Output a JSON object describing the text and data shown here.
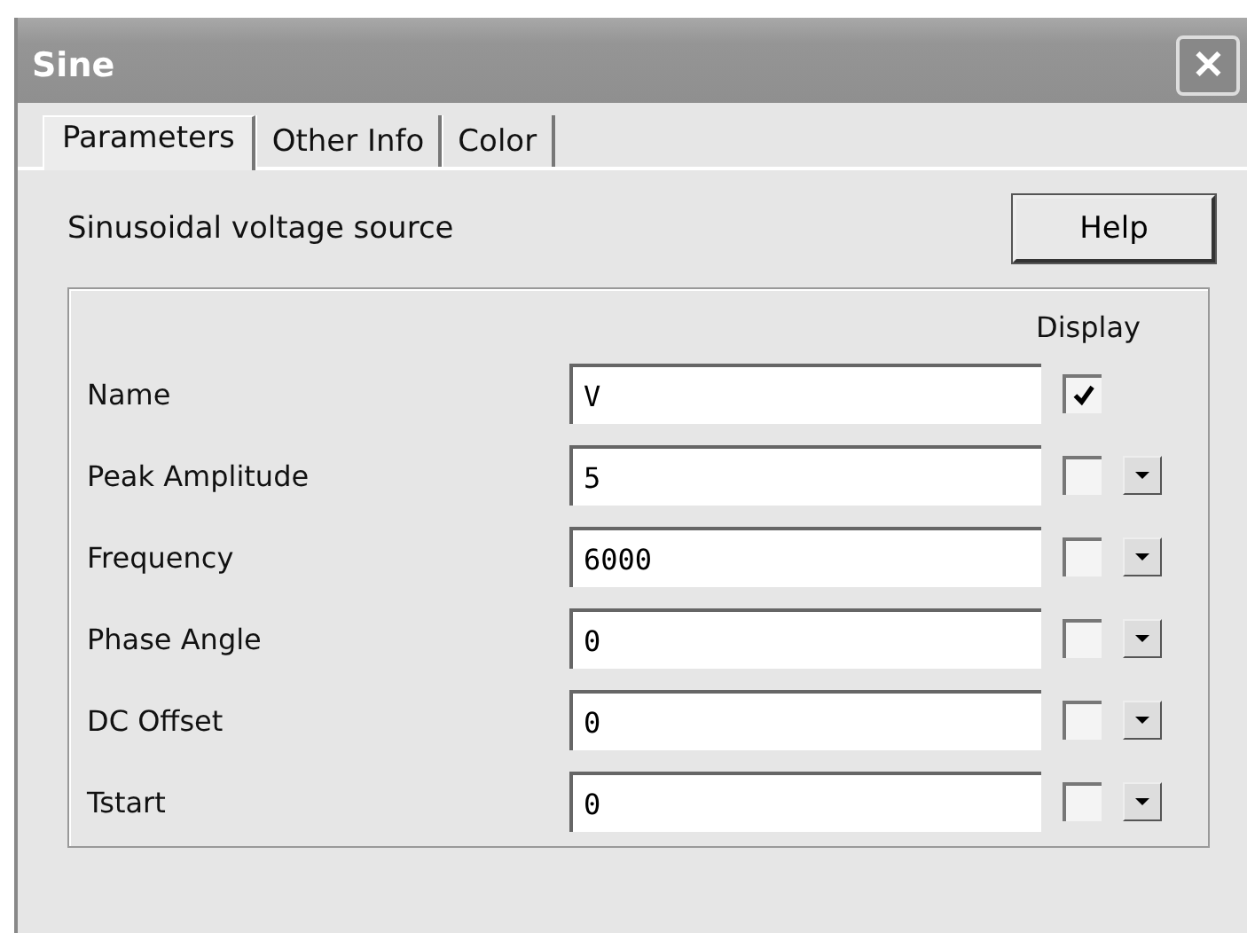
{
  "window": {
    "title": "Sine",
    "close": "✕"
  },
  "tabs": [
    {
      "label": "Parameters",
      "selected": true
    },
    {
      "label": "Other Info",
      "selected": false
    },
    {
      "label": "Color",
      "selected": false
    }
  ],
  "description": "Sinusoidal voltage source",
  "help_button": "Help",
  "display_header": "Display",
  "rows": [
    {
      "label": "Name",
      "value": "V",
      "display": true,
      "kind": "plain"
    },
    {
      "label": "Peak Amplitude",
      "value": "5",
      "display": false,
      "kind": "menu"
    },
    {
      "label": "Frequency",
      "value": "6000",
      "display": false,
      "kind": "menu"
    },
    {
      "label": "Phase Angle",
      "value": "0",
      "display": false,
      "kind": "menu"
    },
    {
      "label": "DC Offset",
      "value": "0",
      "display": false,
      "kind": "menu"
    },
    {
      "label": "Tstart",
      "value": "0",
      "display": false,
      "kind": "menu"
    }
  ]
}
